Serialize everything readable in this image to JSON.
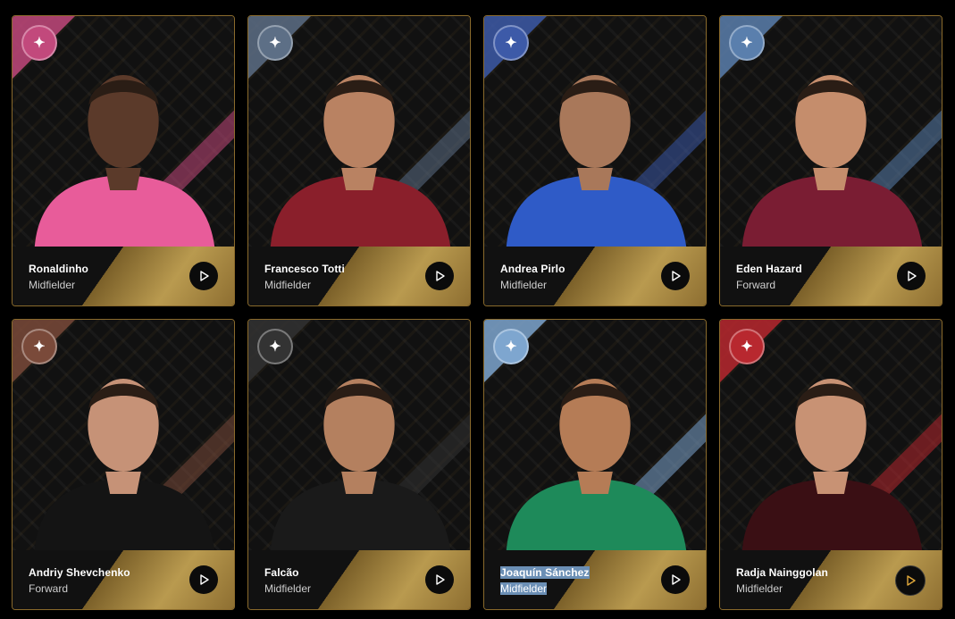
{
  "players": [
    {
      "name": "Ronaldinho",
      "position": "Midfielder",
      "team_color": "#c2497c",
      "shirt_color": "#e85c9a",
      "crest_icon": "lion-crest-icon"
    },
    {
      "name": "Francesco Totti",
      "position": "Midfielder",
      "team_color": "#5d6f86",
      "shirt_color": "#8a1f2b",
      "crest_icon": "stallion-crest-icon"
    },
    {
      "name": "Andrea Pirlo",
      "position": "Midfielder",
      "team_color": "#3d5aa8",
      "shirt_color": "#2f5bc7",
      "crest_icon": "shield-crest-icon"
    },
    {
      "name": "Eden Hazard",
      "position": "Forward",
      "team_color": "#5a7fad",
      "shirt_color": "#7a1d33",
      "crest_icon": "shield-crest-icon"
    },
    {
      "name": "Andriy Shevchenko",
      "position": "Forward",
      "team_color": "#7a4a3a",
      "shirt_color": "#141414",
      "crest_icon": "lion-head-crest-icon"
    },
    {
      "name": "Falcão",
      "position": "Midfielder",
      "team_color": "#333333",
      "shirt_color": "#1a1a1a",
      "crest_icon": "panther-crest-icon"
    },
    {
      "name": "Joaquín Sánchez",
      "position": "Midfielder",
      "team_color": "#7ea6cf",
      "shirt_color": "#1e8a5a",
      "crest_icon": "ring-crest-icon"
    },
    {
      "name": "Radja Nainggolan",
      "position": "Midfielder",
      "team_color": "#b8282f",
      "shirt_color": "#3a0f14",
      "crest_icon": "skull-crest-icon"
    }
  ],
  "accent_color": "#c79a3f",
  "play_icon_color": "#ffffff",
  "play_icon_active_color": "#e0a83a"
}
